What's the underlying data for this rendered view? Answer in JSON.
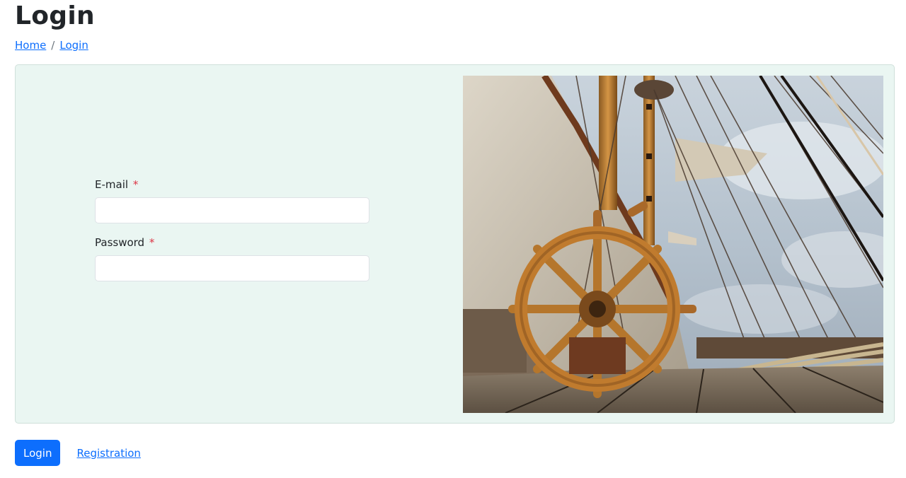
{
  "page": {
    "title": "Login"
  },
  "breadcrumb": {
    "home": "Home",
    "separator": "/",
    "current": "Login"
  },
  "form": {
    "email": {
      "label": "E-mail",
      "required_mark": "*",
      "value": "",
      "placeholder": ""
    },
    "password": {
      "label": "Password",
      "required_mark": "*",
      "value": "",
      "placeholder": ""
    }
  },
  "image": {
    "subject": "ship-wheel-deck-photo"
  },
  "actions": {
    "login_label": "Login",
    "registration_label": "Registration"
  },
  "colors": {
    "accent": "#0d6efd",
    "panel_bg": "#eaf6f2",
    "required": "#dc3545",
    "text": "#212529"
  }
}
